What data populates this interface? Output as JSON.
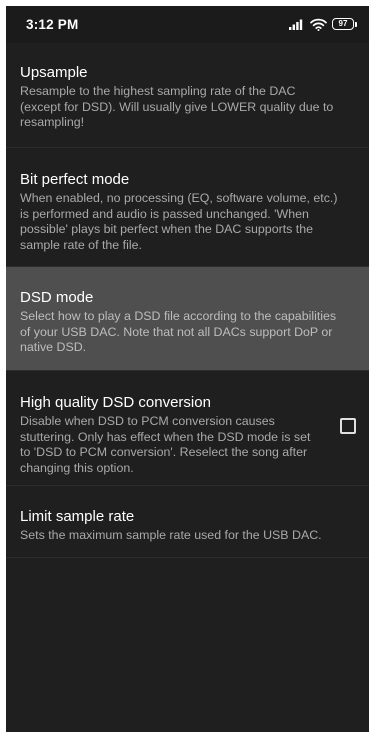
{
  "status_bar": {
    "time": "3:12 PM",
    "battery_level": "97",
    "icons": [
      "signal-icon",
      "wifi-icon",
      "battery-icon"
    ]
  },
  "settings": {
    "items": [
      {
        "title": "Upsample",
        "summary": "Resample to the highest sampling rate of the DAC (except for DSD). Will usually give LOWER quality due to resampling!"
      },
      {
        "title": "Bit perfect mode",
        "summary": "When enabled, no processing (EQ, software volume, etc.) is performed and audio is passed unchanged. 'When possible' plays bit perfect when the DAC supports the sample rate of the file."
      },
      {
        "title": "DSD mode",
        "summary": "Select how to play a DSD file according to the capabilities of your USB DAC. Note that not all DACs support DoP or native DSD."
      },
      {
        "title": "High quality DSD conversion",
        "summary": "Disable when DSD to PCM conversion causes stuttering. Only has effect when the DSD mode is set to 'DSD to PCM conversion'. Reselect the song after changing this option.",
        "checked": false
      },
      {
        "title": "Limit sample rate",
        "summary": "Sets the maximum sample rate used for the USB DAC."
      }
    ]
  },
  "colors": {
    "background": "#1f1f1f",
    "highlight": "#4f4f4f",
    "title_text": "#ffffff",
    "summary_text": "#a9a9a9"
  }
}
